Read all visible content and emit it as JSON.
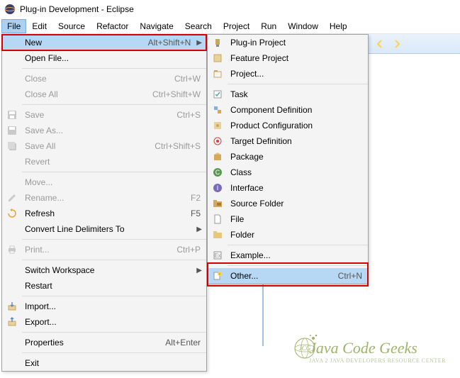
{
  "titlebar": {
    "text": "Plug-in Development - Eclipse"
  },
  "menubar": {
    "items": [
      "File",
      "Edit",
      "Source",
      "Refactor",
      "Navigate",
      "Search",
      "Project",
      "Run",
      "Window",
      "Help"
    ]
  },
  "file_menu": {
    "new": {
      "label": "New",
      "accel": "Alt+Shift+N"
    },
    "open_file": {
      "label": "Open File..."
    },
    "close": {
      "label": "Close",
      "accel": "Ctrl+W"
    },
    "close_all": {
      "label": "Close All",
      "accel": "Ctrl+Shift+W"
    },
    "save": {
      "label": "Save",
      "accel": "Ctrl+S"
    },
    "save_as": {
      "label": "Save As..."
    },
    "save_all": {
      "label": "Save All",
      "accel": "Ctrl+Shift+S"
    },
    "revert": {
      "label": "Revert"
    },
    "move": {
      "label": "Move..."
    },
    "rename": {
      "label": "Rename...",
      "accel": "F2"
    },
    "refresh": {
      "label": "Refresh",
      "accel": "F5"
    },
    "convert_ld": {
      "label": "Convert Line Delimiters To"
    },
    "print": {
      "label": "Print...",
      "accel": "Ctrl+P"
    },
    "switch_ws": {
      "label": "Switch Workspace"
    },
    "restart": {
      "label": "Restart"
    },
    "import": {
      "label": "Import..."
    },
    "export": {
      "label": "Export..."
    },
    "properties": {
      "label": "Properties",
      "accel": "Alt+Enter"
    },
    "exit": {
      "label": "Exit"
    }
  },
  "new_menu": {
    "plugin_project": {
      "label": "Plug-in Project"
    },
    "feature_project": {
      "label": "Feature Project"
    },
    "project": {
      "label": "Project..."
    },
    "task": {
      "label": "Task"
    },
    "component_def": {
      "label": "Component Definition"
    },
    "product_config": {
      "label": "Product Configuration"
    },
    "target_def": {
      "label": "Target Definition"
    },
    "package": {
      "label": "Package"
    },
    "class_": {
      "label": "Class"
    },
    "interface": {
      "label": "Interface"
    },
    "source_folder": {
      "label": "Source Folder"
    },
    "file": {
      "label": "File"
    },
    "folder": {
      "label": "Folder"
    },
    "example": {
      "label": "Example..."
    },
    "other": {
      "label": "Other...",
      "accel": "Ctrl+N"
    }
  },
  "watermark": {
    "title": "Java Code Geeks",
    "subtitle": "Java 2 Java Developers Resource Center"
  }
}
